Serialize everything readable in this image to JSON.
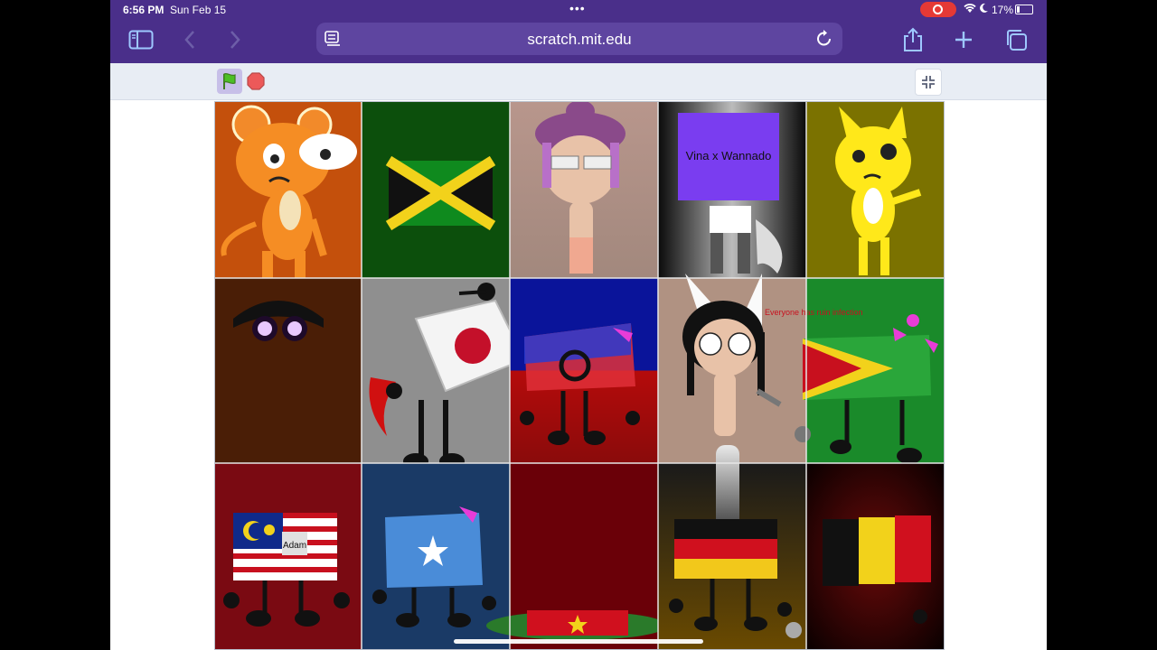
{
  "status_bar": {
    "time": "6:56 PM",
    "date": "Sun Feb 15",
    "battery": "17%"
  },
  "browser": {
    "url": "scratch.mit.edu"
  },
  "stage": {
    "vina_box_text": "Vina x Wannado",
    "ruin_text": "Everyone has ruin infection",
    "adam_label": "Adam"
  },
  "colors": {
    "toolbar_bg": "#4a2f8a",
    "accent_icon": "#9ec8ff"
  },
  "icons": [
    "sidebar-icon",
    "back-icon",
    "forward-icon",
    "reload-icon",
    "share-icon",
    "plus-icon",
    "tabs-icon",
    "green-flag-icon",
    "stop-icon",
    "exit-fullscreen-icon"
  ]
}
